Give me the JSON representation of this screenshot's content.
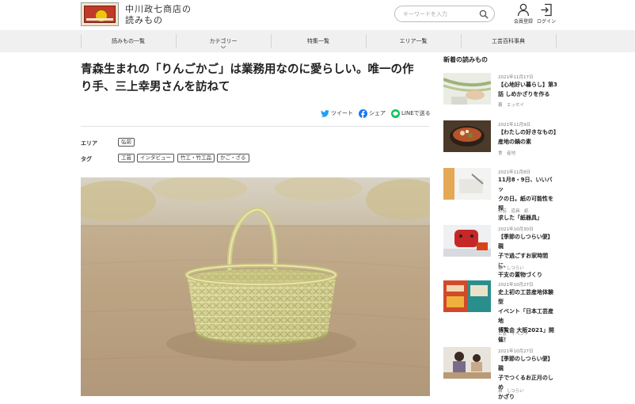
{
  "header": {
    "brand_line1": "中川政七商店の",
    "brand_line2": "読みもの",
    "search_placeholder": "キーワードを入力",
    "register_label": "会員登録",
    "login_label": "ログイン"
  },
  "nav": {
    "items": [
      {
        "label": "読みもの一覧"
      },
      {
        "label": "カテゴリー"
      },
      {
        "label": "特集一覧"
      },
      {
        "label": "エリア一覧"
      },
      {
        "label": "工芸百科事典"
      }
    ]
  },
  "article": {
    "title_line1": "青森生まれの「りんごかご」は業務用なのに愛らしい。唯一の作",
    "title_line2": "り手、三上幸男さんを訪ねて",
    "share": {
      "tweet": "ツイート",
      "share": "シェア",
      "line": "LINEで送る"
    },
    "area_label": "エリア",
    "area_tag": "弘前",
    "tag_label": "タグ",
    "tags": [
      "工芸",
      "インタビュー",
      "竹工・竹工品",
      "かご・ざる"
    ]
  },
  "sidebar": {
    "heading": "新着の読みもの",
    "cards": [
      {
        "date": "2021年11月17日",
        "line1": "【心地好い暮らし】第3",
        "line2": "話 しめかざりを作る",
        "line3": "",
        "line4": "",
        "category": "暮　エッセイ"
      },
      {
        "date": "2021年11月9日",
        "line1": "【わたしの好きなもの】",
        "line2": "産地の鍋の素",
        "line3": "",
        "line4": "",
        "category": "食　産地"
      },
      {
        "date": "2021年11月8日",
        "line1": "11月8・9日、いいバッ",
        "line2": "クの日。紙の可能性を探",
        "line3": "求した「紙器具」",
        "line4": "",
        "category": "工芸　道具　紙"
      },
      {
        "date": "2021年10月30日",
        "line1": "【季節のしつらい便】親",
        "line2": "子で過ごすお家時間に、",
        "line3": "干支の置物づくり",
        "line4": "",
        "category": "暮　しつらい"
      },
      {
        "date": "2021年10月27日",
        "line1": "史上初の工芸産地体験型",
        "line2": "イベント「日本工芸産地",
        "line3": "博覧会 大阪2021」開",
        "line4": "催！",
        "category": "工芸　イベント"
      },
      {
        "date": "2021年10月27日",
        "line1": "【季節のしつらい便】親",
        "line2": "子でつくるお正月のしめ",
        "line3": "かざり",
        "line4": "",
        "category": "暮　しつらい"
      }
    ]
  },
  "colors": {
    "twitter": "#1da1f2",
    "facebook": "#1877f2",
    "line": "#06c755",
    "nav_bg": "#f0f0f0"
  }
}
